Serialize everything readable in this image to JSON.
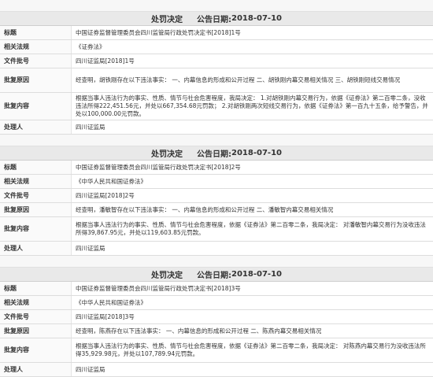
{
  "labels": {
    "title": "标题",
    "law": "相关法规",
    "doc_no": "文件批号",
    "reason": "批复原因",
    "content": "批复内容",
    "person": "处理人"
  },
  "sections": [
    {
      "header_type": "处罚决定",
      "header_date_label": "公告日期:",
      "header_date": "2018-07-10",
      "title": "中国证券监督管理委员会四川监管局行政处罚决定书[2018]1号",
      "law": "《证券法》",
      "doc_no": "四川证监局[2018]1号",
      "reason": "经查明，胡铁刚存在以下违法事实： 一、内幕信息的形成和公开过程 二、胡铁刚内幕交易相关情况 三、胡铁刚短线交易情况",
      "content": "根据当事人违法行为的事实、性质、情节与社会危害程度，我局决定： 1.对胡铁刚内幕交易行为，依据《证券法》第二百零二条，没收违法所得222,451.56元，并处以667,354.68元罚款； 2.对胡铁刚两次短线交易行为，依据《证券法》第一百九十五条，给予警告，并处以100,000.00元罚款。",
      "person": "四川证监局"
    },
    {
      "header_type": "处罚决定",
      "header_date_label": "公告日期:",
      "header_date": "2018-07-10",
      "title": "中国证券监督管理委员会四川监管局行政处罚决定书[2018]2号",
      "law": "《中华人民共和国证券法》",
      "doc_no": "四川证监局[2018]2号",
      "reason": "经查明，潘敏智存在以下违法事实： 一、内幕信息的形成和公开过程 二、潘敏智内幕交易相关情况",
      "content": "根据当事人违法行为的事实、性质、情节与社会危害程度，依据《证券法》第二百零二条，我局决定： 对潘敏智内幕交易行为没收违法所得39,867.95元，并处以119,603.85元罚款。",
      "person": "四川证监局"
    },
    {
      "header_type": "处罚决定",
      "header_date_label": "公告日期:",
      "header_date": "2018-07-10",
      "title": "中国证券监督管理委员会四川监管局行政处罚决定书[2018]3号",
      "law": "《中华人民共和国证券法》",
      "doc_no": "四川证监局[2018]3号",
      "reason": "经查明，陈燕存在以下违法事实： 一、内幕信息的形成和公开过程 二、陈燕内幕交易相关情况",
      "content": "根据当事人违法行为的事实、性质、情节与社会危害程度，依据《证券法》第二百零二条，我局决定： 对陈燕内幕交易行为没收违法所得35,929.98元，并处以107,789.94元罚款。",
      "person": "四川证监局"
    }
  ]
}
